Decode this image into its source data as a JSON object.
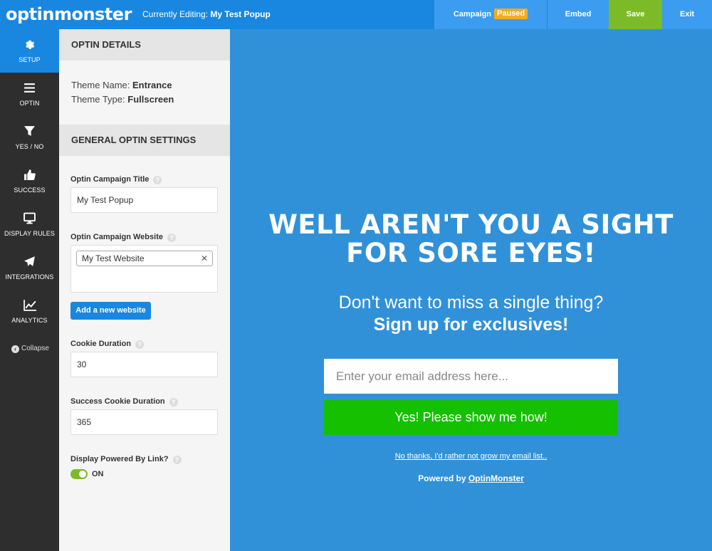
{
  "header": {
    "logo": "optinmonster",
    "editing_prefix": "Currently Editing:",
    "editing_name": "My Test Popup",
    "campaign_label": "Campaign",
    "campaign_status": "Paused",
    "embed_label": "Embed",
    "save_label": "Save",
    "exit_label": "Exit"
  },
  "sidebar": {
    "items": [
      {
        "label": "SETUP",
        "icon": "gear-icon",
        "active": true
      },
      {
        "label": "OPTIN",
        "icon": "menu-icon"
      },
      {
        "label": "YES / NO",
        "icon": "filter-icon"
      },
      {
        "label": "SUCCESS",
        "icon": "thumbs-up-icon"
      },
      {
        "label": "DISPLAY RULES",
        "icon": "monitor-icon"
      },
      {
        "label": "INTEGRATIONS",
        "icon": "paper-plane-icon"
      },
      {
        "label": "ANALYTICS",
        "icon": "line-chart-icon"
      }
    ],
    "collapse_label": "Collapse"
  },
  "panel": {
    "optin_details_title": "OPTIN DETAILS",
    "theme_name_label": "Theme Name:",
    "theme_name_value": "Entrance",
    "theme_type_label": "Theme Type:",
    "theme_type_value": "Fullscreen",
    "general_title": "GENERAL OPTIN SETTINGS",
    "campaign_title_label": "Optin Campaign Title",
    "campaign_title_value": "My Test Popup",
    "website_label": "Optin Campaign Website",
    "website_tag": "My Test Website",
    "add_website_label": "Add a new website",
    "cookie_label": "Cookie Duration",
    "cookie_value": "30",
    "success_cookie_label": "Success Cookie Duration",
    "success_cookie_value": "365",
    "powered_link_label": "Display Powered By Link?",
    "powered_link_state": "ON",
    "help_glyph": "?"
  },
  "preview": {
    "headline_line1": "WELL AREN'T YOU A SIGHT",
    "headline_line2": "FOR SORE EYES!",
    "subline1": "Don't want to miss a single thing?",
    "subline2": "Sign up for exclusives!",
    "email_placeholder": "Enter your email address here...",
    "cta_label": "Yes! Please show me how!",
    "no_thanks": "No thanks, I'd rather not grow my email list..",
    "powered_prefix": "Powered by",
    "powered_link": "OptinMonster"
  },
  "colors": {
    "brand_blue": "#1987e0",
    "preview_bg": "#3091d9",
    "save_green": "#7dba27",
    "cta_green": "#14c000",
    "paused_badge": "#f0ad1e"
  }
}
